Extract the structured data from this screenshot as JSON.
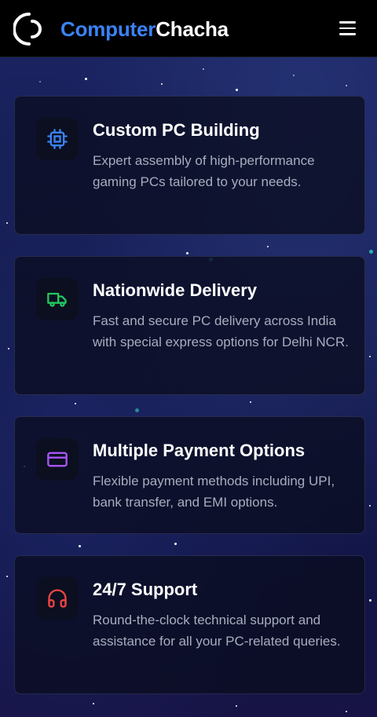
{
  "header": {
    "brand_part1": "Computer",
    "brand_part2": "Chacha",
    "logo_icon": "circle-arc-logo-icon",
    "menu_icon": "hamburger-menu-icon"
  },
  "colors": {
    "brand_blue": "#3b82f6",
    "custom_pc_icon": "#3b82f6",
    "delivery_icon": "#22c55e",
    "payment_icon": "#a855f7",
    "support_icon": "#ef4444"
  },
  "services": [
    {
      "icon": "cpu-chip-icon",
      "title": "Custom PC Building",
      "description": "Expert assembly of high-performance gaming PCs tailored to your needs."
    },
    {
      "icon": "delivery-truck-icon",
      "title": "Nationwide Delivery",
      "description": "Fast and secure PC delivery across India with special express options for Delhi NCR."
    },
    {
      "icon": "credit-card-icon",
      "title": "Multiple Payment Options",
      "description": "Flexible payment methods including UPI, bank transfer, and EMI options."
    },
    {
      "icon": "headphones-icon",
      "title": "24/7 Support",
      "description": "Round-the-clock technical support and assistance for all your PC-related queries."
    }
  ]
}
